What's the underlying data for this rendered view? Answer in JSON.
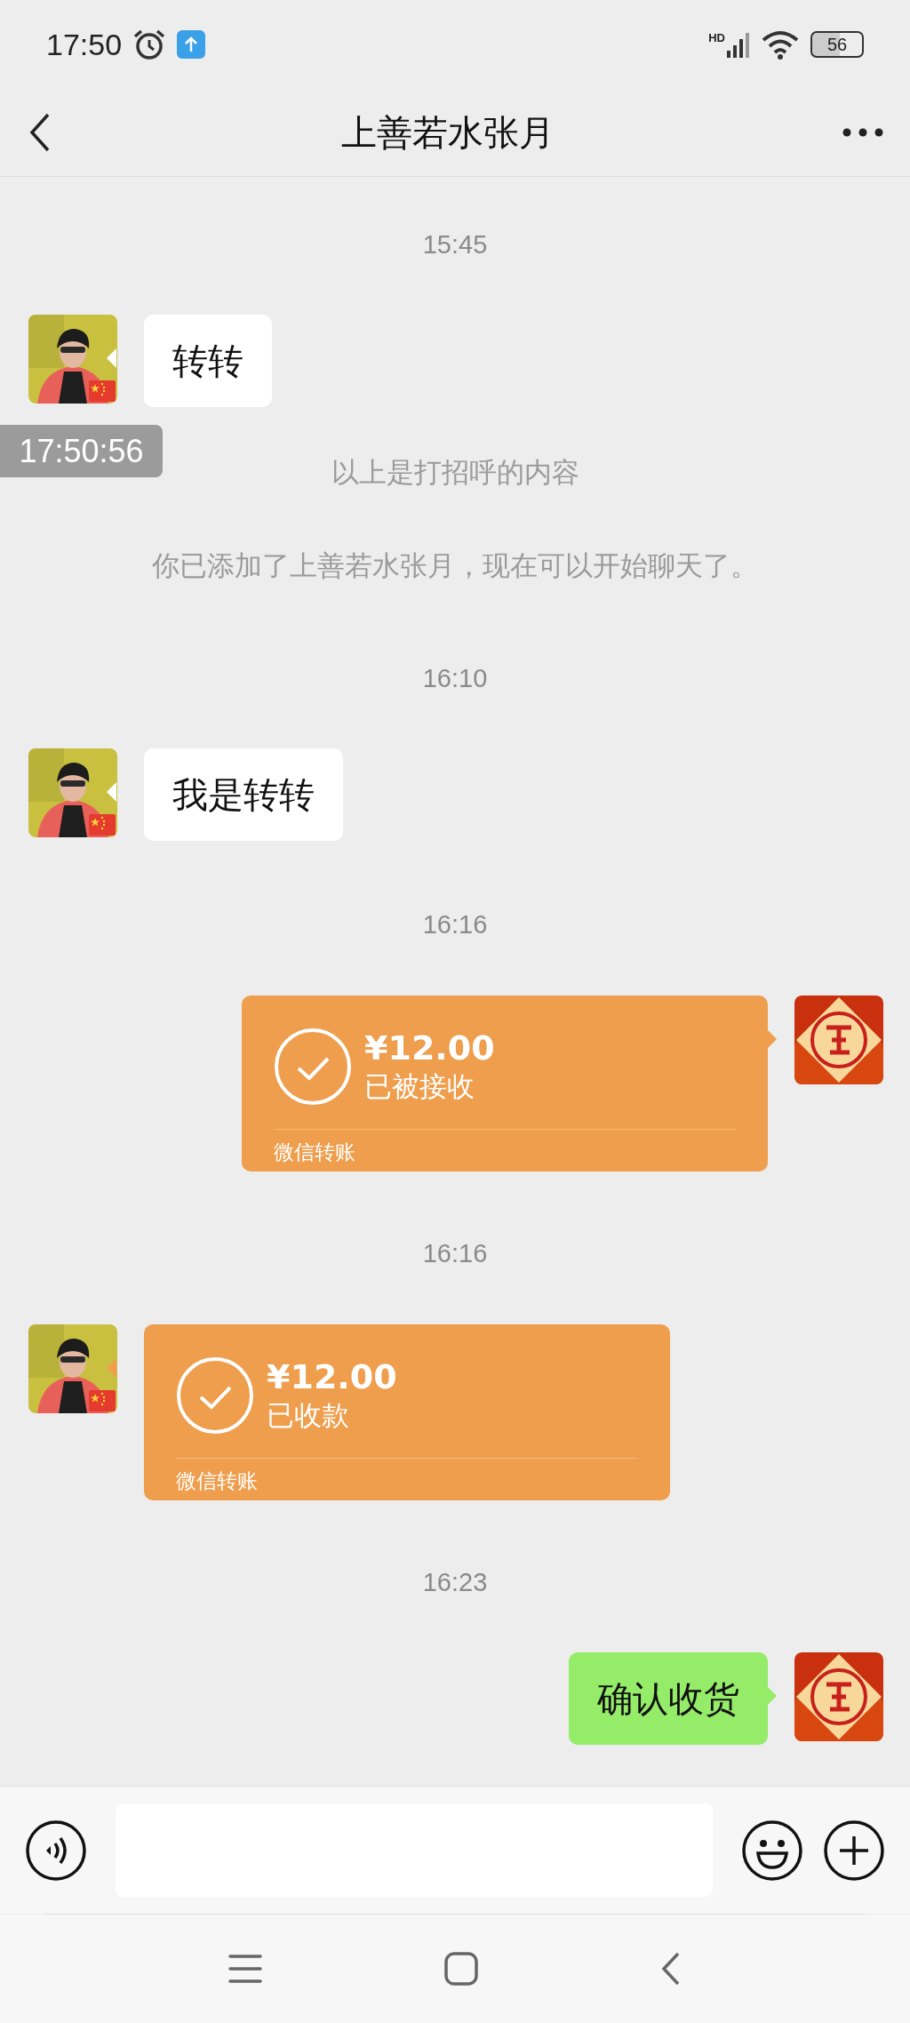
{
  "status_bar": {
    "time": "17:50",
    "network": "HD",
    "battery": "56"
  },
  "header": {
    "title": "上善若水张月"
  },
  "messages": [
    {
      "kind": "time",
      "text": "15:45"
    },
    {
      "kind": "text",
      "outgoing": false,
      "text": "转转"
    },
    {
      "kind": "system",
      "text": "以上是打招呼的内容"
    },
    {
      "kind": "system",
      "text": "你已添加了上善若水张月，现在可以开始聊天了。"
    },
    {
      "kind": "time",
      "text": "16:10"
    },
    {
      "kind": "text",
      "outgoing": false,
      "text": "我是转转"
    },
    {
      "kind": "time",
      "text": "16:16"
    },
    {
      "kind": "transfer",
      "outgoing": true,
      "amount": "¥12.00",
      "status": "已被接收",
      "footer": "微信转账"
    },
    {
      "kind": "time",
      "text": "16:16"
    },
    {
      "kind": "transfer",
      "outgoing": false,
      "amount": "¥12.00",
      "status": "已收款",
      "footer": "微信转账"
    },
    {
      "kind": "time",
      "text": "16:23"
    },
    {
      "kind": "text",
      "outgoing": true,
      "text": "确认收货"
    }
  ],
  "overlay": {
    "text": "17:50:56"
  }
}
